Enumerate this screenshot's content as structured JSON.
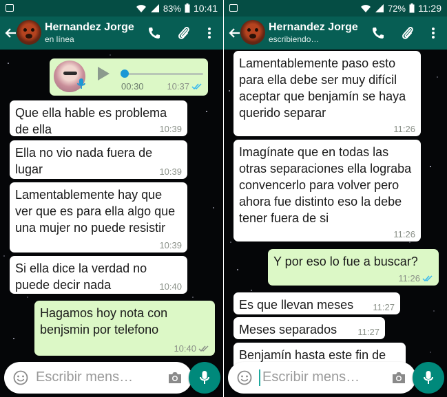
{
  "left_screen": {
    "status_bar": {
      "battery": "83%",
      "time": "10:41"
    },
    "header": {
      "name": "Hernandez Jorge",
      "status": "en línea"
    },
    "voice_message": {
      "duration": "00:30",
      "time": "10:37"
    },
    "messages": [
      {
        "dir": "in",
        "text": "Que ella hable es problema de ella",
        "time": "10:39"
      },
      {
        "dir": "in",
        "text": "Ella no vio nada fuera de lugar",
        "time": "10:39"
      },
      {
        "dir": "in",
        "text": "Lamentablemente hay que ver que es para ella algo que una mujer no puede resistir",
        "time": "10:39"
      },
      {
        "dir": "in",
        "text": "Si ella dice la verdad no puede decir nada",
        "time": "10:40"
      },
      {
        "dir": "out",
        "text": "Hagamos hoy nota con benjsmin por telefono",
        "time": "10:40"
      }
    ],
    "composer": {
      "placeholder": "Escribir mens…"
    }
  },
  "right_screen": {
    "status_bar": {
      "battery": "72%",
      "time": "11:29"
    },
    "header": {
      "name": "Hernandez Jorge",
      "status": "escribiendo…"
    },
    "messages": [
      {
        "dir": "in",
        "text": "Lamentablemente paso esto para ella debe ser muy difícil aceptar que benjamín se haya querido separar",
        "time": "11:26"
      },
      {
        "dir": "in",
        "text": "Imagínate que en todas las otras separaciones ella lograba convencerlo para volver pero ahora fue distinto eso la debe tener fuera de si",
        "time": "11:26"
      },
      {
        "dir": "out",
        "text": "Y por eso lo fue a buscar?",
        "time": "11:26"
      },
      {
        "dir": "in",
        "text": "Es que llevan meses",
        "time": "11:27"
      },
      {
        "dir": "in",
        "text": "Meses separados",
        "time": "11:27"
      },
      {
        "dir": "in",
        "text": "Benjamín hasta este fin de",
        "time": ""
      }
    ],
    "composer": {
      "placeholder": "Escribir mens…"
    }
  },
  "icons": {
    "back": "arrow-left-icon",
    "call": "phone-icon",
    "attach": "paperclip-icon",
    "menu": "more-vert-icon",
    "emoji": "emoji-icon",
    "camera": "camera-icon",
    "mic": "mic-icon",
    "read_receipt": "double-check-icon"
  },
  "colors": {
    "statusbar": "#054d44",
    "appbar": "#075e54",
    "incoming_bubble": "#ffffff",
    "outgoing_bubble": "#dcf8c6",
    "mic_button": "#00897b",
    "read_ticks": "#34b7f1"
  }
}
